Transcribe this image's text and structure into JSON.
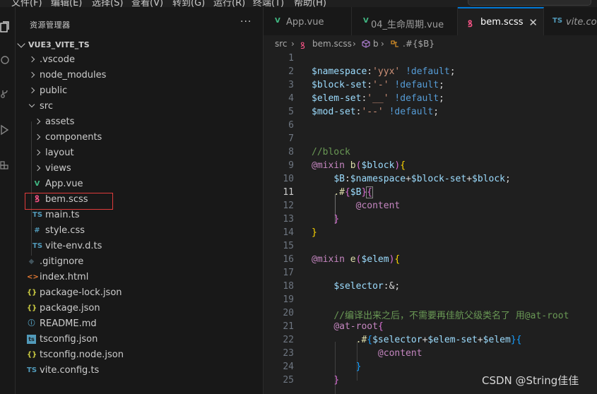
{
  "menu": [
    "文件(F)",
    "编辑(E)",
    "选择(S)",
    "查看(V)",
    "转到(G)",
    "运行(R)",
    "终端(T)",
    "帮助(H)"
  ],
  "sidebar": {
    "title": "资源管理器",
    "more": "···",
    "project": "VUE3_VITE_TS",
    "tree": [
      {
        "name": ".vscode",
        "kind": "folder",
        "state": "closed",
        "depth": 1
      },
      {
        "name": "node_modules",
        "kind": "folder",
        "state": "closed",
        "depth": 1
      },
      {
        "name": "public",
        "kind": "folder",
        "state": "closed",
        "depth": 1
      },
      {
        "name": "src",
        "kind": "folder",
        "state": "open",
        "depth": 1
      },
      {
        "name": "assets",
        "kind": "folder",
        "state": "closed",
        "depth": 2
      },
      {
        "name": "components",
        "kind": "folder",
        "state": "closed",
        "depth": 2
      },
      {
        "name": "layout",
        "kind": "folder",
        "state": "closed",
        "depth": 2
      },
      {
        "name": "views",
        "kind": "folder",
        "state": "closed",
        "depth": 2
      },
      {
        "name": "App.vue",
        "kind": "vue",
        "depth": 2
      },
      {
        "name": "bem.scss",
        "kind": "scss",
        "depth": 2,
        "selected": true
      },
      {
        "name": "main.ts",
        "kind": "ts",
        "depth": 2
      },
      {
        "name": "style.css",
        "kind": "css",
        "depth": 2
      },
      {
        "name": "vite-env.d.ts",
        "kind": "ts",
        "depth": 2
      },
      {
        "name": ".gitignore",
        "kind": "git",
        "depth": 1
      },
      {
        "name": "index.html",
        "kind": "html",
        "depth": 1
      },
      {
        "name": "package-lock.json",
        "kind": "json",
        "depth": 1
      },
      {
        "name": "package.json",
        "kind": "json",
        "depth": 1
      },
      {
        "name": "README.md",
        "kind": "info",
        "depth": 1
      },
      {
        "name": "tsconfig.json",
        "kind": "tsconfig",
        "depth": 1
      },
      {
        "name": "tsconfig.node.json",
        "kind": "json",
        "depth": 1
      },
      {
        "name": "vite.config.ts",
        "kind": "ts",
        "depth": 1
      }
    ]
  },
  "tabs": [
    {
      "label": "App.vue",
      "icon": "V",
      "icon_color": "#41b883",
      "active": false
    },
    {
      "label": "04_生命周期.vue",
      "icon": "V",
      "icon_color": "#41b883",
      "active": false
    },
    {
      "label": "bem.scss",
      "icon": "ꝸ",
      "icon_color": "#f55385",
      "active": true,
      "close": "✕"
    },
    {
      "label": "vite.config.ts",
      "icon": "TS",
      "icon_color": "#519aba",
      "active": false
    }
  ],
  "breadcrumb": {
    "root": "src",
    "sep": "›",
    "file": "bem.scss",
    "mixin": "b",
    "selector": ".#{$B}"
  },
  "editor": {
    "current_line": 11,
    "line_numbers": [
      "1",
      "2",
      "3",
      "4",
      "5",
      "6",
      "7",
      "8",
      "9",
      "10",
      "11",
      "12",
      "13",
      "14",
      "15",
      "16",
      "17",
      "18",
      "19",
      "20",
      "21",
      "22",
      "23",
      "24",
      "25"
    ]
  },
  "colors": {
    "accent": "#0078d4",
    "selection_outline": "#e03c3c",
    "scss_icon": "#f55385",
    "vue_icon": "#41b883",
    "ts_icon": "#519aba",
    "json_icon": "#cbcb41"
  },
  "watermark": "CSDN @String佳佳"
}
